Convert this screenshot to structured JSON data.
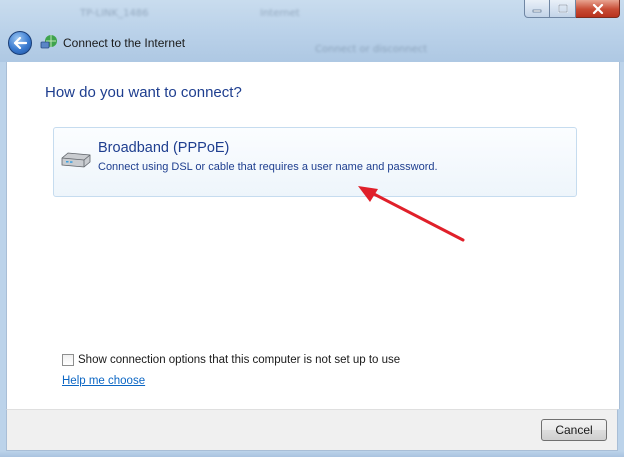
{
  "window": {
    "title": "Connect to the Internet",
    "background_text": [
      "TP-LINK_1486",
      "Internet",
      "Connect or disconnect"
    ]
  },
  "icons": {
    "back": "back-arrow-icon",
    "network": "network-connection-icon",
    "modem": "broadband-modem-icon",
    "minimize": "minimize-icon",
    "maximize": "maximize-icon",
    "close": "close-icon"
  },
  "main": {
    "heading": "How do you want to connect?",
    "options": [
      {
        "title": "Broadband (PPPoE)",
        "description": "Connect using DSL or cable that requires a user name and password."
      }
    ],
    "show_options_checkbox": {
      "label": "Show connection options that this computer is not set up to use",
      "checked": false
    },
    "help_link": "Help me choose"
  },
  "footer": {
    "cancel_label": "Cancel"
  },
  "colors": {
    "heading": "#1e3e8f",
    "link": "#0b66c4",
    "annotation_arrow": "#e0202a",
    "titlebar": "#bcd3ea"
  }
}
